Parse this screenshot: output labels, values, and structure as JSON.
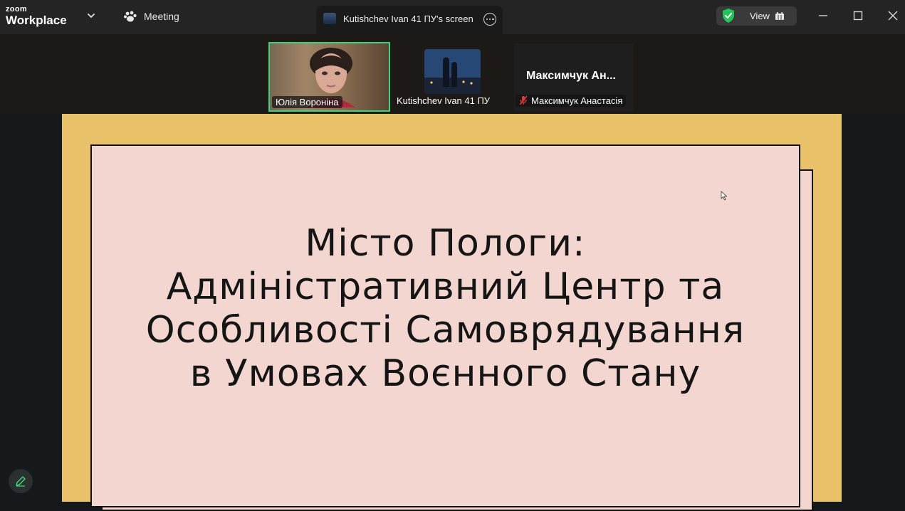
{
  "app": {
    "logo_small": "zoom",
    "logo_big": "Workplace",
    "meeting_label": "Meeting"
  },
  "share_tab": {
    "label": "Kutishchev Ivan 41 ПУ's screen"
  },
  "view_button": {
    "label": "View"
  },
  "participants": [
    {
      "name": "Юлія Вороніна",
      "active_speaker": true
    },
    {
      "name": "Kutishchev Ivan 41 ПУ"
    },
    {
      "name": "Максимчук Анастасія",
      "display_name": "Максимчук  Ан...",
      "muted": true
    }
  ],
  "slide": {
    "title_lines": [
      "Місто Пологи:",
      "Адміністративний Центр та",
      "Особливості Самоврядування",
      "в Умовах Воєнного Стану"
    ]
  },
  "colors": {
    "accent_green": "#39d679",
    "slide_frame": "#e9c26a",
    "slide_card": "#f2d6cf",
    "titlebar": "#242424"
  },
  "icons": {
    "meeting": "paw-icon",
    "security": "shield-check-icon",
    "view": "grid-icon",
    "annotate": "pencil-icon",
    "mic": "mic-muted-icon"
  }
}
